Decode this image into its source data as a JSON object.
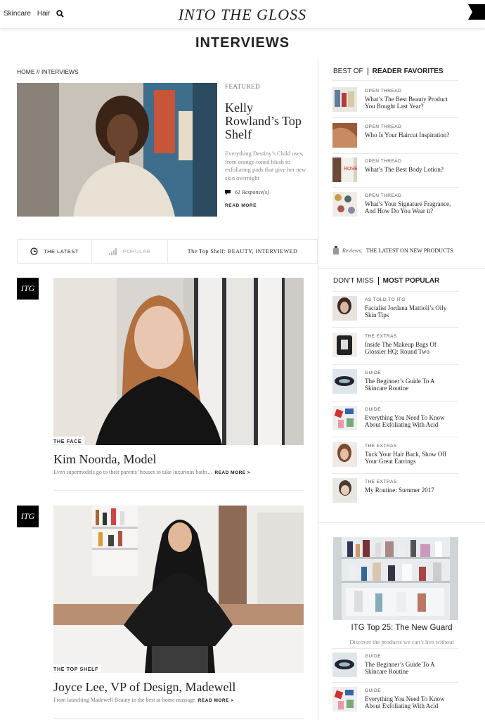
{
  "nav": {
    "skincare": "Skincare",
    "hair": "Hair",
    "logo": "INTO THE GLOSS"
  },
  "page": {
    "title": "INTERVIEWS",
    "breadcrumb": "HOME // INTERVIEWS"
  },
  "featured": {
    "kicker": "FEATURED",
    "title": "Kelly Rowland’s Top Shelf",
    "dek": "Everything Destiny’s Child uses, from orange-toned blush to exfoliating pads that give her new skin overnight",
    "comments": "61 Response(s)",
    "read_more": "READ MORE"
  },
  "tabs": {
    "latest": "THE LATEST",
    "popular": "POPULAR",
    "topshelf": "The Top Shelf: BEAUTY, INTERVIEWED"
  },
  "reviews": {
    "label": "Reviews:",
    "text": "THE LATEST ON NEW PRODUCTS"
  },
  "best_of": {
    "h1": "BEST OF",
    "h2": "READER FAVORITES",
    "items": [
      {
        "kicker": "OPEN THREAD",
        "title": "What’s The Best Beauty Product You Bought Last Year?"
      },
      {
        "kicker": "OPEN THREAD",
        "title": "Who Is Your Haircut Inspiration?"
      },
      {
        "kicker": "OPEN THREAD",
        "title": "What’s The Best Body Lotion?"
      },
      {
        "kicker": "OPEN THREAD",
        "title": "What’s Your Signature Fragrance, And How Do You Wear it?"
      }
    ]
  },
  "dont_miss": {
    "h1": "DON’T MISS",
    "h2": "MOST POPULAR",
    "items": [
      {
        "kicker": "AS TOLD TO ITG",
        "title": "Facialist Jordana Mattioli’s Oily Skin Tips"
      },
      {
        "kicker": "THE EXTRAS",
        "title": "Inside The Makeup Bags Of Glossier HQ: Round Two"
      },
      {
        "kicker": "GUIDE",
        "title": "The Beginner’s Guide To A Skincare Routine"
      },
      {
        "kicker": "GUIDE",
        "title": "Everything You Need To Know About Exfoliating With Acid"
      },
      {
        "kicker": "THE EXTRAS",
        "title": "Tuck Your Hair Back, Show Off Your Great Earrings"
      },
      {
        "kicker": "THE EXTRAS",
        "title": "My Routine: Summer 2017"
      }
    ]
  },
  "promo": {
    "title": "ITG Top 25: The New Guard",
    "dek": "Discover the products we can’t live without",
    "items": [
      {
        "kicker": "GUIDE",
        "title": "The Beginner’s Guide To A Skincare Routine"
      },
      {
        "kicker": "GUIDE",
        "title": "Everything You Need To Know About Exfoliating With Acid"
      }
    ]
  },
  "posts": [
    {
      "badge": "ITG",
      "tag": "THE FACE",
      "title": "Kim Noorda, Model",
      "dek": "Even supermodels go to their parents’ houses to take luxurious baths...",
      "read_more": "READ MORE >"
    },
    {
      "badge": "ITG",
      "tag": "THE TOP SHELF",
      "title": "Joyce Lee, VP of Design, Madewell",
      "dek": "From launching Madewell Beauty to the best at-home massage",
      "read_more": "READ MORE >"
    }
  ]
}
